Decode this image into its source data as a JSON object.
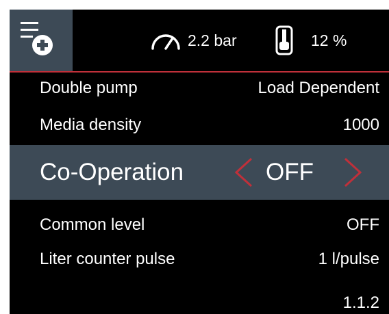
{
  "topbar": {
    "menu_icon": "menu-add-icon",
    "pressure": {
      "icon": "gauge-icon",
      "value": "2.2 bar"
    },
    "level": {
      "icon": "tank-level-icon",
      "value": "12 %"
    }
  },
  "settings": [
    {
      "label": "Double pump",
      "value": "Load Dependent"
    },
    {
      "label": "Media density",
      "value": "1000"
    }
  ],
  "selected_setting": {
    "label": "Co-Operation",
    "value": "OFF",
    "prev_icon": "chevron-left-icon",
    "next_icon": "chevron-right-icon"
  },
  "settings_below": [
    {
      "label": "Common level",
      "value": "OFF"
    },
    {
      "label": "Liter counter pulse",
      "value": "1 l/pulse"
    }
  ],
  "version": "1.1.2",
  "colors": {
    "background": "#000000",
    "highlight": "#3d4a56",
    "accent": "#c0303a",
    "text": "#ffffff"
  }
}
